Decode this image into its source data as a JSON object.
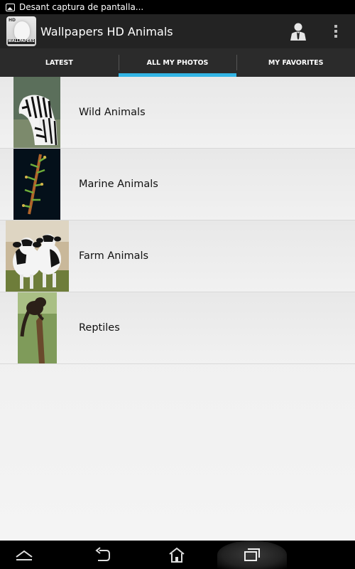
{
  "status_bar": {
    "notification_text": "Desant captura de pantalla..."
  },
  "action_bar": {
    "app_title": "Wallpapers HD Animals",
    "app_icon_badge": "HD",
    "app_icon_caption": "WALLPAPERS"
  },
  "tabs": [
    {
      "label": "LATEST",
      "active": false
    },
    {
      "label": "ALL MY PHOTOS",
      "active": true
    },
    {
      "label": "MY FAVORITES",
      "active": false
    }
  ],
  "categories": [
    {
      "label": "Wild Animals",
      "thumbnail": "zebras"
    },
    {
      "label": "Marine Animals",
      "thumbnail": "ghost-pipefish"
    },
    {
      "label": "Farm Animals",
      "thumbnail": "calves"
    },
    {
      "label": "Reptiles",
      "thumbnail": "monkey-on-branch"
    }
  ],
  "colors": {
    "accent": "#33b5e5",
    "action_bar": "#232323",
    "tab_bar": "#2b2b2b"
  },
  "icons": {
    "status": "image-icon",
    "account": "account-icon",
    "overflow": "overflow-menu-icon",
    "nav": [
      "back-arrow-icon",
      "undo-icon",
      "home-icon",
      "recent-apps-icon"
    ]
  }
}
